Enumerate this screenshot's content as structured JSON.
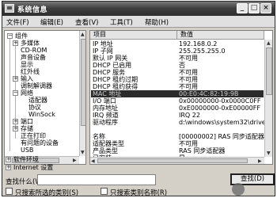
{
  "window": {
    "title": "系统信息"
  },
  "titlebar": {
    "min": "_",
    "max": "□",
    "close": "×"
  },
  "menu": [
    "文件(F)",
    "编辑(E)",
    "查看(V)",
    "工具(T)",
    "帮助(H)"
  ],
  "tree": {
    "items": [
      {
        "label": "组件",
        "expander": "−"
      },
      {
        "label": "多媒体",
        "expander": "+"
      },
      {
        "label": "CD-ROM",
        "expander": ""
      },
      {
        "label": "声音设备",
        "expander": ""
      },
      {
        "label": "显示",
        "expander": ""
      },
      {
        "label": "红外线",
        "expander": ""
      },
      {
        "label": "输入",
        "expander": "+"
      },
      {
        "label": "调制解调器",
        "expander": ""
      },
      {
        "label": "网络",
        "expander": "−"
      },
      {
        "label": "适配器",
        "expander": ""
      },
      {
        "label": "协议",
        "expander": ""
      },
      {
        "label": "WinSock",
        "expander": ""
      },
      {
        "label": "端口",
        "expander": "+"
      },
      {
        "label": "存储",
        "expander": "+"
      },
      {
        "label": "正在打印",
        "expander": ""
      },
      {
        "label": "有问题的设备",
        "expander": ""
      },
      {
        "label": "USB",
        "expander": ""
      },
      {
        "label": "软件环境",
        "expander": "+"
      },
      {
        "label": "Internet 设置",
        "expander": "+"
      }
    ]
  },
  "list": {
    "columns": [
      "项目",
      "数值"
    ],
    "rows": [
      {
        "name": "IP 地址",
        "value": "192.168.0.2"
      },
      {
        "name": "IP 子网",
        "value": "255.255.255.0"
      },
      {
        "name": "默认 IP 网关",
        "value": "不可用"
      },
      {
        "name": "DHCP 已启用",
        "value": "否"
      },
      {
        "name": "DHCP 服务",
        "value": "不可用"
      },
      {
        "name": "DHCP 租约过期",
        "value": "不可用"
      },
      {
        "name": "DHCP 租约获得",
        "value": "不可用"
      },
      {
        "name": "MAC 地址",
        "value": "00:E0:4C:82:19:9B"
      },
      {
        "name": "I/O 端口",
        "value": "0x00000000-0x0000C0FF"
      },
      {
        "name": "内存地址",
        "value": "0xE0000000-0xE00000FF"
      },
      {
        "name": "IRQ 频道",
        "value": "IRQ 22"
      },
      {
        "name": "驱动程序",
        "value": "d:\\windows\\system32\\drivers\\"
      },
      {
        "name": "",
        "value": ""
      },
      {
        "name": "名称",
        "value": "[00000002] RAS 同步适配器"
      },
      {
        "name": "适配器类型",
        "value": "不可用"
      },
      {
        "name": "产品类型",
        "value": "RAS 同步适配器"
      },
      {
        "name": "已安装",
        "value": "是"
      },
      {
        "name": "PNP 设备 ID",
        "value": "不可用"
      }
    ]
  },
  "search": {
    "label": "查找什么(W):",
    "value": "",
    "find_button": "查找(D)",
    "option1": "只搜索所选的类别(S)",
    "option2": "只搜索类别名称(R)"
  }
}
